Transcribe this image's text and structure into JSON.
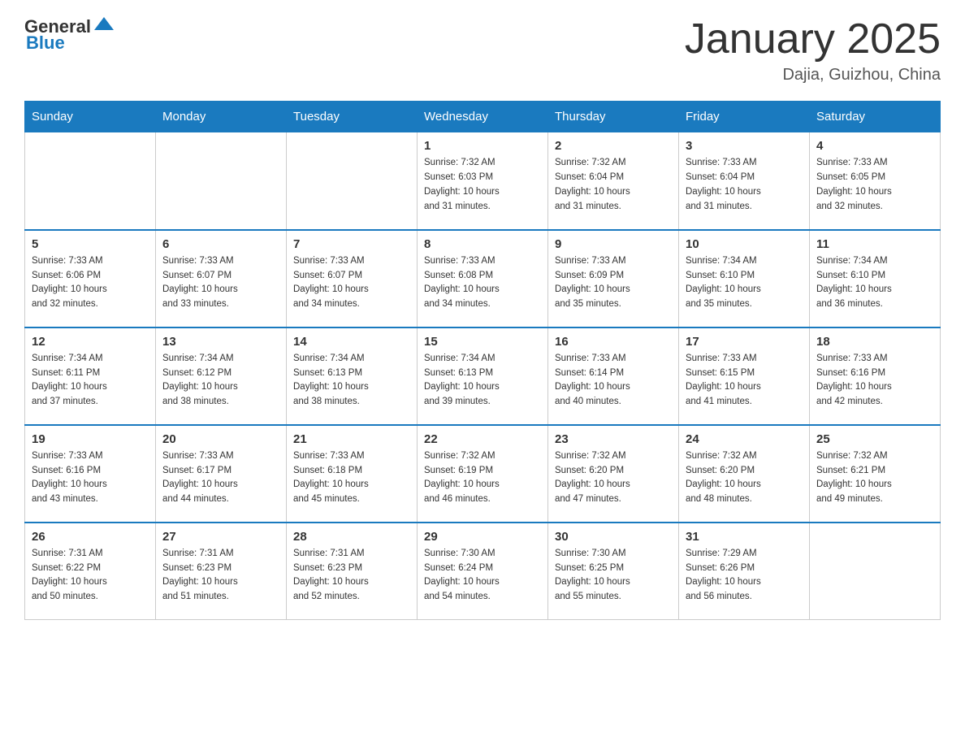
{
  "header": {
    "logo_text_black": "General",
    "logo_text_blue": "Blue",
    "month_title": "January 2025",
    "location": "Dajia, Guizhou, China"
  },
  "days_of_week": [
    "Sunday",
    "Monday",
    "Tuesday",
    "Wednesday",
    "Thursday",
    "Friday",
    "Saturday"
  ],
  "weeks": [
    [
      {
        "day": "",
        "info": ""
      },
      {
        "day": "",
        "info": ""
      },
      {
        "day": "",
        "info": ""
      },
      {
        "day": "1",
        "info": "Sunrise: 7:32 AM\nSunset: 6:03 PM\nDaylight: 10 hours\nand 31 minutes."
      },
      {
        "day": "2",
        "info": "Sunrise: 7:32 AM\nSunset: 6:04 PM\nDaylight: 10 hours\nand 31 minutes."
      },
      {
        "day": "3",
        "info": "Sunrise: 7:33 AM\nSunset: 6:04 PM\nDaylight: 10 hours\nand 31 minutes."
      },
      {
        "day": "4",
        "info": "Sunrise: 7:33 AM\nSunset: 6:05 PM\nDaylight: 10 hours\nand 32 minutes."
      }
    ],
    [
      {
        "day": "5",
        "info": "Sunrise: 7:33 AM\nSunset: 6:06 PM\nDaylight: 10 hours\nand 32 minutes."
      },
      {
        "day": "6",
        "info": "Sunrise: 7:33 AM\nSunset: 6:07 PM\nDaylight: 10 hours\nand 33 minutes."
      },
      {
        "day": "7",
        "info": "Sunrise: 7:33 AM\nSunset: 6:07 PM\nDaylight: 10 hours\nand 34 minutes."
      },
      {
        "day": "8",
        "info": "Sunrise: 7:33 AM\nSunset: 6:08 PM\nDaylight: 10 hours\nand 34 minutes."
      },
      {
        "day": "9",
        "info": "Sunrise: 7:33 AM\nSunset: 6:09 PM\nDaylight: 10 hours\nand 35 minutes."
      },
      {
        "day": "10",
        "info": "Sunrise: 7:34 AM\nSunset: 6:10 PM\nDaylight: 10 hours\nand 35 minutes."
      },
      {
        "day": "11",
        "info": "Sunrise: 7:34 AM\nSunset: 6:10 PM\nDaylight: 10 hours\nand 36 minutes."
      }
    ],
    [
      {
        "day": "12",
        "info": "Sunrise: 7:34 AM\nSunset: 6:11 PM\nDaylight: 10 hours\nand 37 minutes."
      },
      {
        "day": "13",
        "info": "Sunrise: 7:34 AM\nSunset: 6:12 PM\nDaylight: 10 hours\nand 38 minutes."
      },
      {
        "day": "14",
        "info": "Sunrise: 7:34 AM\nSunset: 6:13 PM\nDaylight: 10 hours\nand 38 minutes."
      },
      {
        "day": "15",
        "info": "Sunrise: 7:34 AM\nSunset: 6:13 PM\nDaylight: 10 hours\nand 39 minutes."
      },
      {
        "day": "16",
        "info": "Sunrise: 7:33 AM\nSunset: 6:14 PM\nDaylight: 10 hours\nand 40 minutes."
      },
      {
        "day": "17",
        "info": "Sunrise: 7:33 AM\nSunset: 6:15 PM\nDaylight: 10 hours\nand 41 minutes."
      },
      {
        "day": "18",
        "info": "Sunrise: 7:33 AM\nSunset: 6:16 PM\nDaylight: 10 hours\nand 42 minutes."
      }
    ],
    [
      {
        "day": "19",
        "info": "Sunrise: 7:33 AM\nSunset: 6:16 PM\nDaylight: 10 hours\nand 43 minutes."
      },
      {
        "day": "20",
        "info": "Sunrise: 7:33 AM\nSunset: 6:17 PM\nDaylight: 10 hours\nand 44 minutes."
      },
      {
        "day": "21",
        "info": "Sunrise: 7:33 AM\nSunset: 6:18 PM\nDaylight: 10 hours\nand 45 minutes."
      },
      {
        "day": "22",
        "info": "Sunrise: 7:32 AM\nSunset: 6:19 PM\nDaylight: 10 hours\nand 46 minutes."
      },
      {
        "day": "23",
        "info": "Sunrise: 7:32 AM\nSunset: 6:20 PM\nDaylight: 10 hours\nand 47 minutes."
      },
      {
        "day": "24",
        "info": "Sunrise: 7:32 AM\nSunset: 6:20 PM\nDaylight: 10 hours\nand 48 minutes."
      },
      {
        "day": "25",
        "info": "Sunrise: 7:32 AM\nSunset: 6:21 PM\nDaylight: 10 hours\nand 49 minutes."
      }
    ],
    [
      {
        "day": "26",
        "info": "Sunrise: 7:31 AM\nSunset: 6:22 PM\nDaylight: 10 hours\nand 50 minutes."
      },
      {
        "day": "27",
        "info": "Sunrise: 7:31 AM\nSunset: 6:23 PM\nDaylight: 10 hours\nand 51 minutes."
      },
      {
        "day": "28",
        "info": "Sunrise: 7:31 AM\nSunset: 6:23 PM\nDaylight: 10 hours\nand 52 minutes."
      },
      {
        "day": "29",
        "info": "Sunrise: 7:30 AM\nSunset: 6:24 PM\nDaylight: 10 hours\nand 54 minutes."
      },
      {
        "day": "30",
        "info": "Sunrise: 7:30 AM\nSunset: 6:25 PM\nDaylight: 10 hours\nand 55 minutes."
      },
      {
        "day": "31",
        "info": "Sunrise: 7:29 AM\nSunset: 6:26 PM\nDaylight: 10 hours\nand 56 minutes."
      },
      {
        "day": "",
        "info": ""
      }
    ]
  ]
}
